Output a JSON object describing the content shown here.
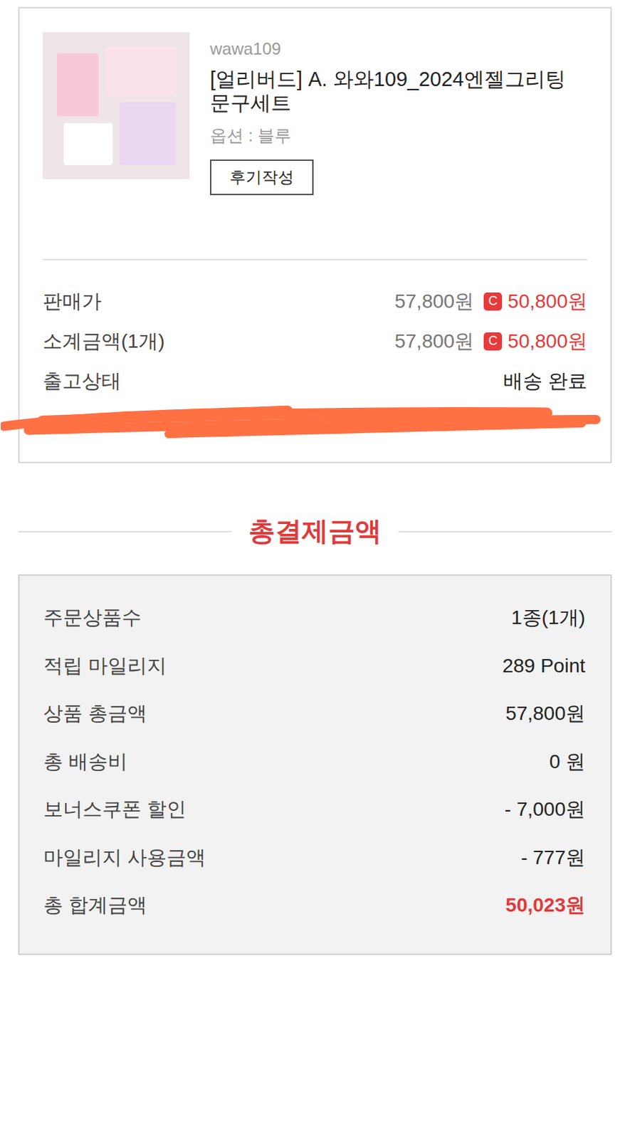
{
  "product": {
    "seller": "wawa109",
    "title": "[얼리버드] A. 와와109_2024엔젤그리팅 문구세트",
    "option": "옵션 : 블루",
    "review_button": "후기작성"
  },
  "detail_rows": [
    {
      "kind": "price",
      "label": "판매가",
      "original": "57,800원",
      "badge": "C",
      "price": "50,800원"
    },
    {
      "kind": "price",
      "label": "소계금액(1개)",
      "original": "57,800원",
      "badge": "C",
      "price": "50,800원"
    },
    {
      "kind": "text",
      "label": "출고상태",
      "value": "배송 완료"
    }
  ],
  "redacted": true,
  "summary": {
    "heading": "총결제금액",
    "rows": [
      {
        "label": "주문상품수",
        "value": "1종(1개)",
        "highlight": false
      },
      {
        "label": "적립 마일리지",
        "value": "289 Point",
        "highlight": false
      },
      {
        "label": "상품 총금액",
        "value": "57,800원",
        "highlight": false
      },
      {
        "label": "총 배송비",
        "value": "0 원",
        "highlight": false
      },
      {
        "label": "보너스쿠폰 할인",
        "value": "- 7,000원",
        "highlight": false
      },
      {
        "label": "마일리지 사용금액",
        "value": "- 777원",
        "highlight": false
      },
      {
        "label": "총 합계금액",
        "value": "50,023원",
        "highlight": true
      }
    ]
  }
}
